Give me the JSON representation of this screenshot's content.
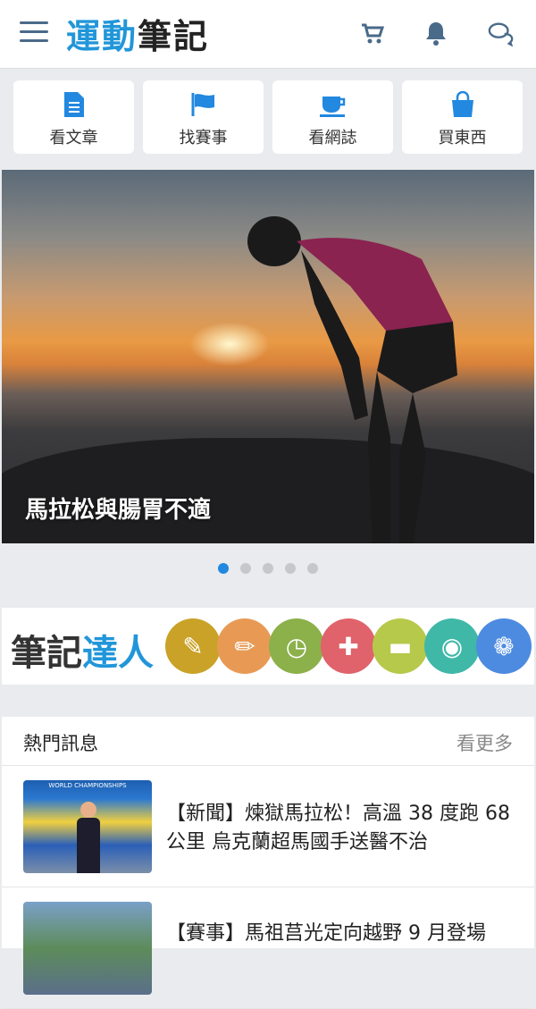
{
  "header": {
    "logo_part1": "運動",
    "logo_part2": "筆記",
    "icons": [
      "menu-icon",
      "cart-icon",
      "bell-icon",
      "chat-icon"
    ]
  },
  "quick_links": [
    {
      "label": "看文章",
      "icon": "document-icon"
    },
    {
      "label": "找賽事",
      "icon": "flag-icon"
    },
    {
      "label": "看網誌",
      "icon": "cup-icon"
    },
    {
      "label": "買東西",
      "icon": "shopping-bag-icon"
    }
  ],
  "hero": {
    "caption": "馬拉松與腸胃不適",
    "slide_count": 5,
    "active_slide": 1
  },
  "expert": {
    "title_part1": "筆記",
    "title_part2": "達人",
    "circles": [
      {
        "icon": "quill-icon",
        "color": "#c9a227"
      },
      {
        "icon": "pencil-icon",
        "color": "#e89a55"
      },
      {
        "icon": "stopwatch-icon",
        "color": "#8cb04a"
      },
      {
        "icon": "medical-cross-icon",
        "color": "#e0626a"
      },
      {
        "icon": "train-icon",
        "color": "#b6c94a"
      },
      {
        "icon": "camera-icon",
        "color": "#3fb8a8"
      },
      {
        "icon": "bike-icon",
        "color": "#4d8be0"
      }
    ]
  },
  "hot": {
    "title": "熱門訊息",
    "more": "看更多",
    "items": [
      {
        "text": "【新聞】煉獄馬拉松！高溫 38 度跑 68 公里 烏克蘭超馬國手送醫不治",
        "thumb_caption": "WORLD CHAMPIONSHIPS"
      },
      {
        "text": "【賽事】馬祖莒光定向越野 9 月登場",
        "thumb_caption": ""
      }
    ]
  },
  "colors": {
    "brand": "#2196d9",
    "accent": "#2288e0"
  }
}
